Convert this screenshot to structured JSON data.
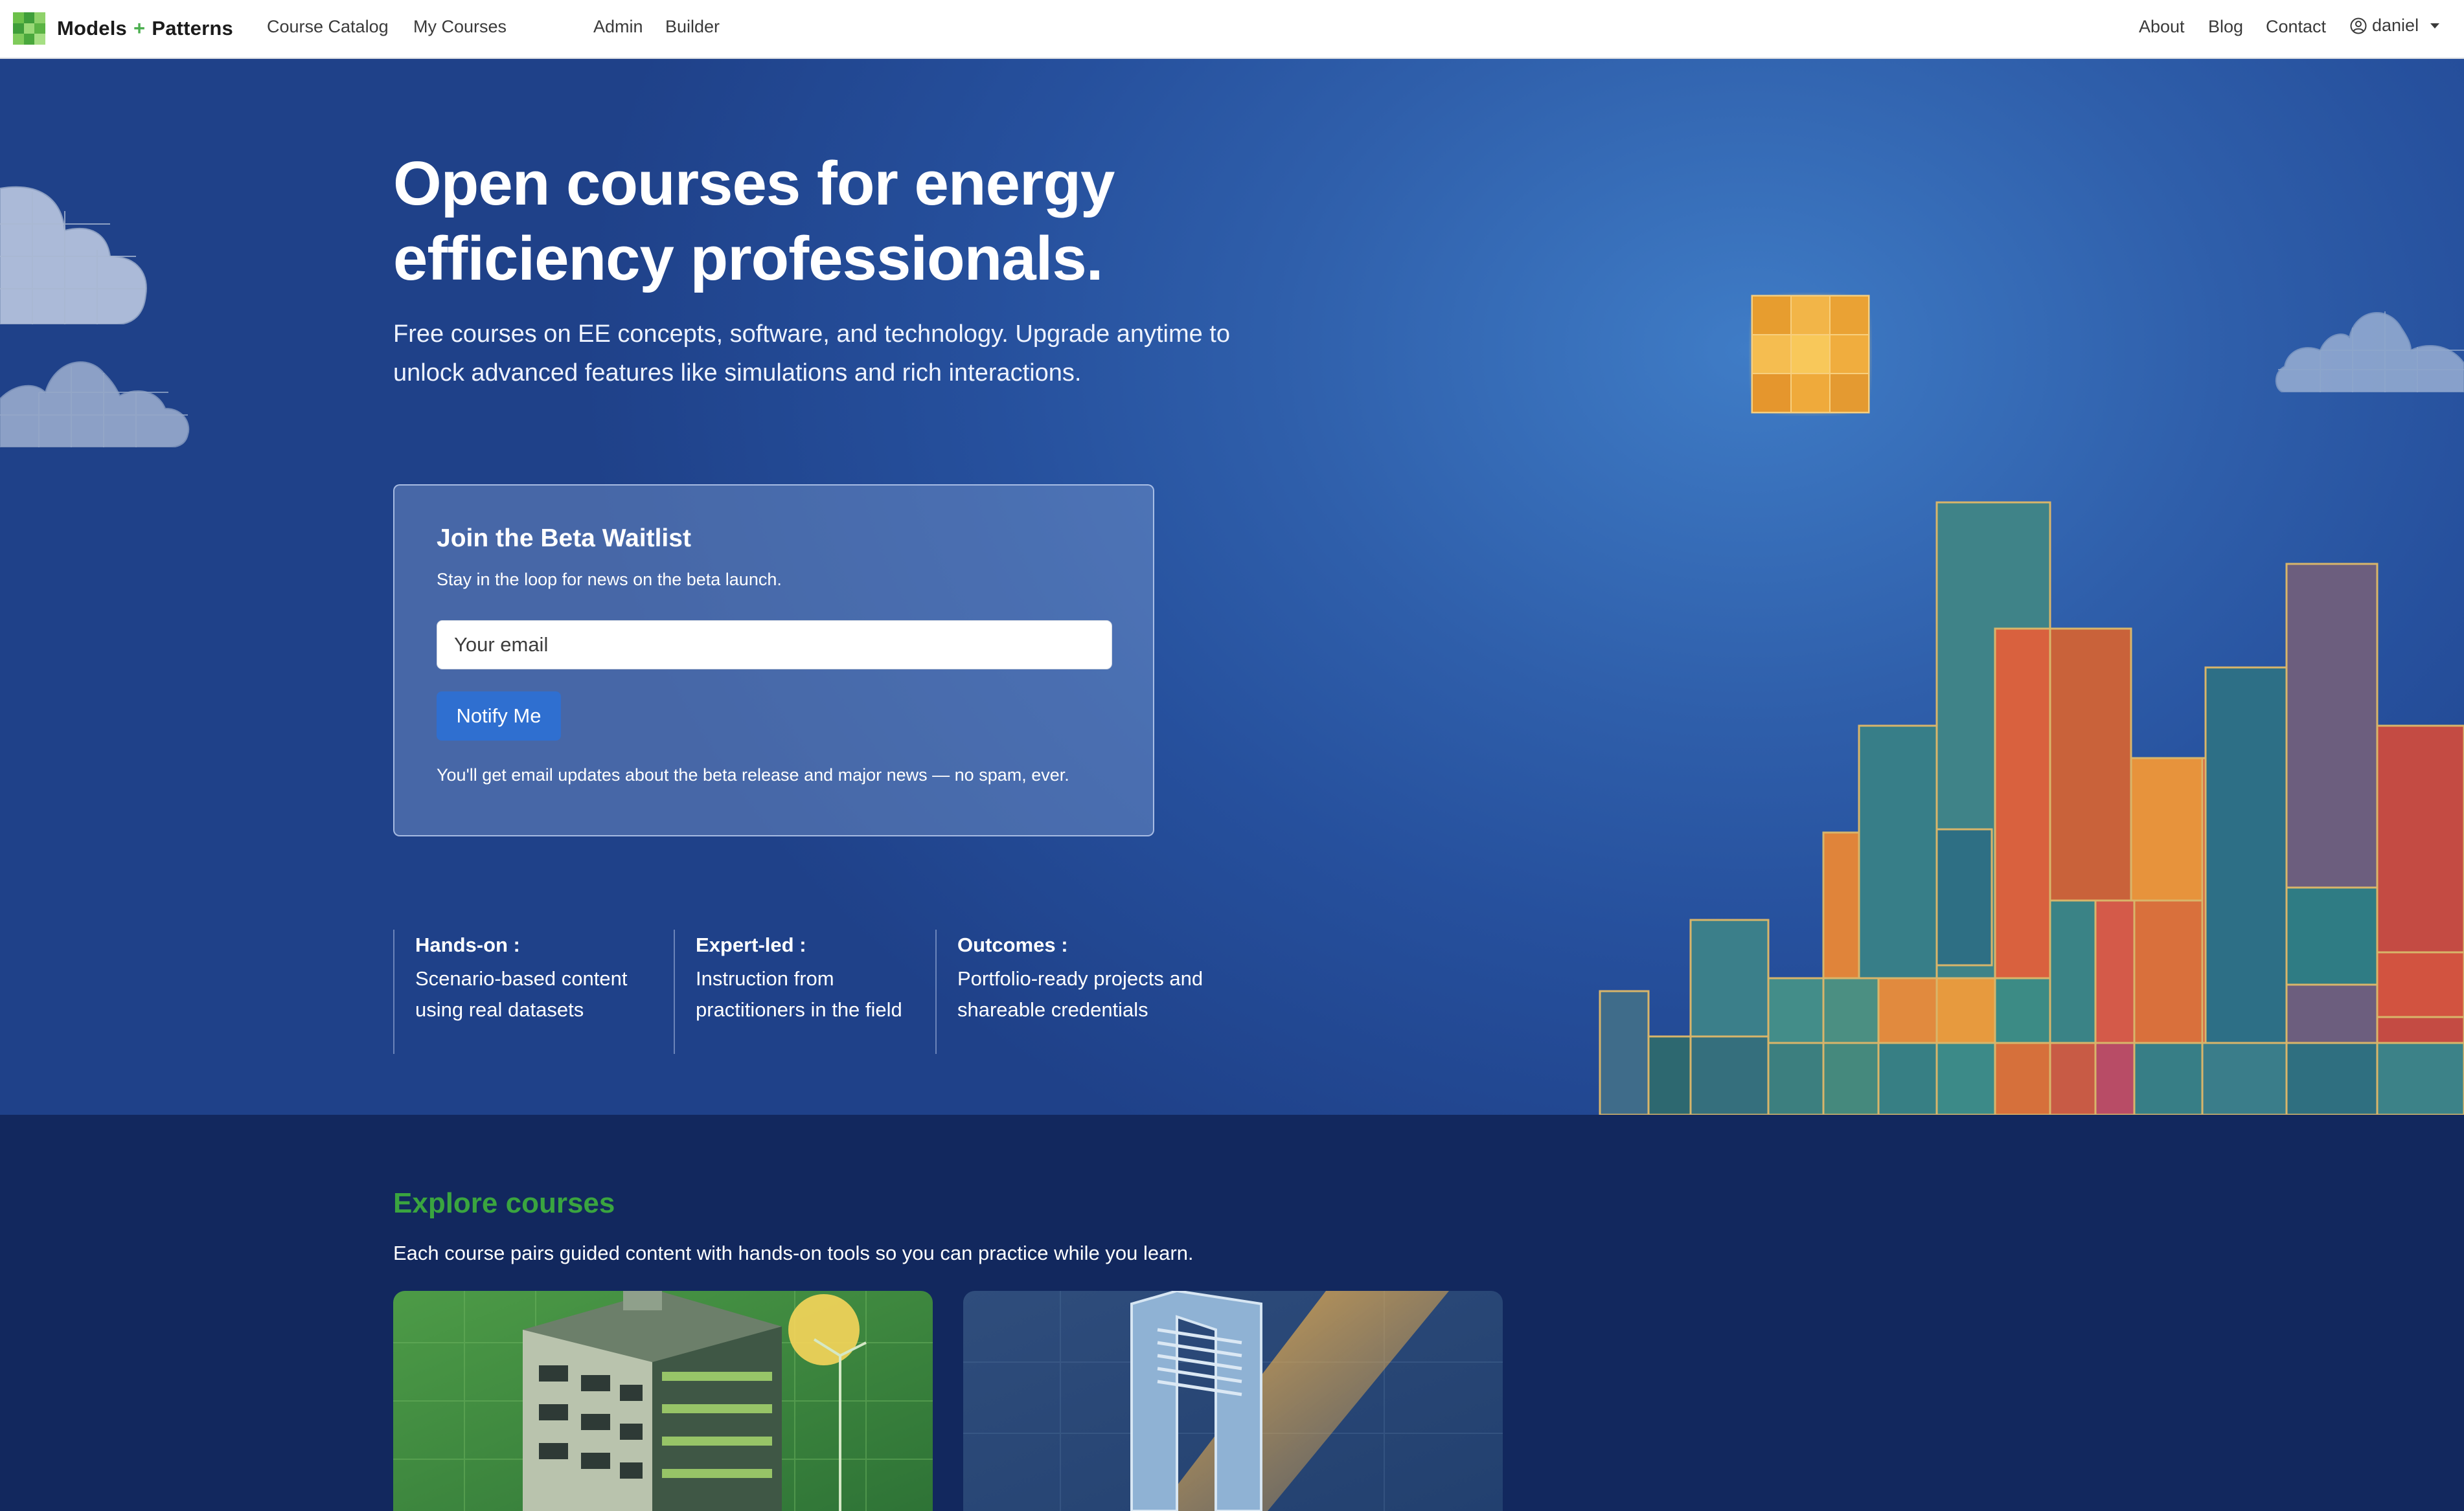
{
  "nav": {
    "brand_left": "Models",
    "brand_plus": "+",
    "brand_right": "Patterns",
    "links_left": [
      "Course Catalog",
      "My Courses",
      "Admin",
      "Builder"
    ],
    "links_right": [
      "About",
      "Blog",
      "Contact"
    ],
    "user": "daniel"
  },
  "hero": {
    "title": "Open courses for energy efficiency professionals.",
    "subtitle": "Free courses on EE concepts, software, and technology. Upgrade anytime to unlock advanced features like simulations and rich interactions."
  },
  "waitlist": {
    "title": "Join the Beta Waitlist",
    "subtitle": "Stay in the loop for news on the beta launch.",
    "email_placeholder": "Your email",
    "button_label": "Notify Me",
    "note": "You'll get email updates about the beta release and major news — no spam, ever."
  },
  "features": [
    {
      "title": "Hands-on :",
      "description": "Scenario-based content using real datasets"
    },
    {
      "title": "Expert-led :",
      "description": "Instruction from practitioners in the field"
    },
    {
      "title": "Outcomes :",
      "description": "Portfolio-ready projects and shareable credentials"
    }
  ],
  "explore": {
    "title": "Explore courses",
    "subtitle": "Each course pairs guided content with hands-on tools so you can practice while you learn."
  },
  "colors": {
    "accent_blue": "#2f6fd0",
    "explore_green": "#3aa53f",
    "hero_bg": "#2a58a3",
    "explore_bg": "#12285e"
  }
}
